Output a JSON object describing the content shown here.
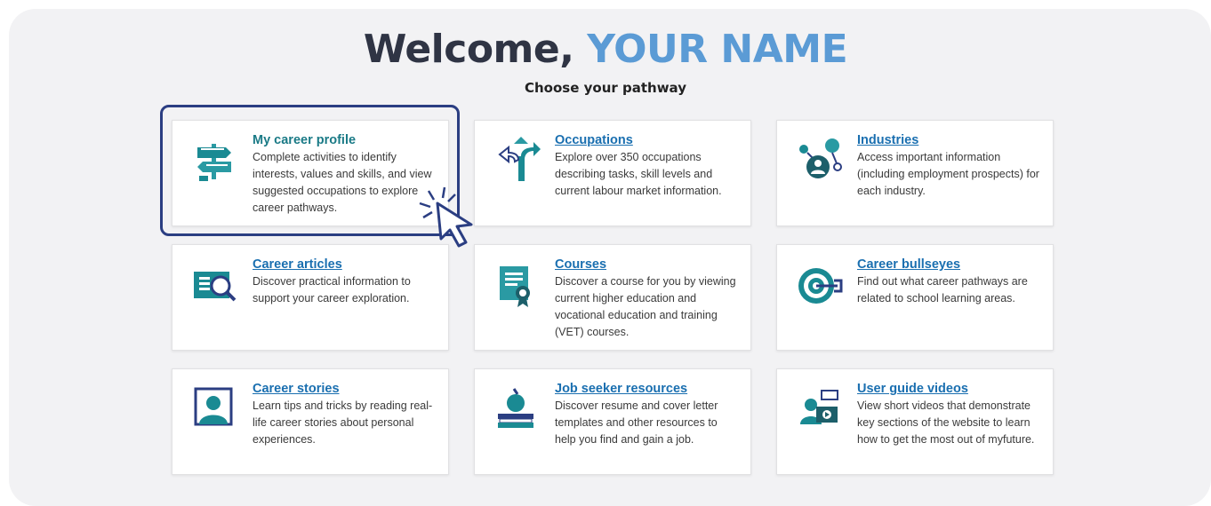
{
  "header": {
    "welcome_prefix": "Welcome, ",
    "user_name": "YOUR NAME",
    "subtitle": "Choose your pathway"
  },
  "colors": {
    "panel_bg": "#f2f2f4",
    "title_dark": "#2f3444",
    "name_accent": "#5b9bd5",
    "link": "#1a6fb0",
    "icon_teal": "#1a8a93",
    "highlight_border": "#2b3e82"
  },
  "cards": [
    {
      "title": "My career profile",
      "icon": "signpost-icon",
      "desc": "Complete activities to identify interests, values and skills, and view suggested occupations to explore career pathways."
    },
    {
      "title": "Occupations",
      "icon": "directions-arrows-icon",
      "desc": "Explore over 350 occupations describing tasks, skill levels and current labour market information."
    },
    {
      "title": "Industries",
      "icon": "industry-network-icon",
      "desc": "Access important information (including employment prospects) for each industry."
    },
    {
      "title": "Career articles",
      "icon": "article-search-icon",
      "desc": "Discover practical information to support your career exploration."
    },
    {
      "title": "Courses",
      "icon": "certificate-icon",
      "desc": "Discover a course for you by viewing current higher education and vocational education and training (VET) courses."
    },
    {
      "title": "Career bullseyes",
      "icon": "bullseye-target-icon",
      "desc": "Find out what career pathways are related to school learning areas."
    },
    {
      "title": "Career stories",
      "icon": "person-story-icon",
      "desc": "Learn tips and tricks by reading real-life career stories about personal experiences."
    },
    {
      "title": "Job seeker resources",
      "icon": "apple-books-icon",
      "desc": "Discover resume and cover letter templates and other resources to help you find and gain a job."
    },
    {
      "title": "User guide videos",
      "icon": "video-guide-icon",
      "desc": "View short videos that demonstrate key sections of the website to learn how to get the most out of myfuture."
    }
  ]
}
